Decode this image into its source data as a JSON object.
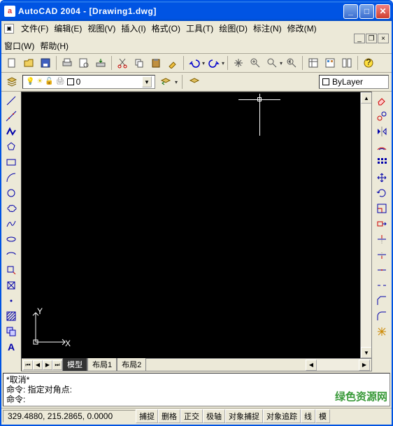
{
  "titlebar": {
    "app_icon_letter": "a",
    "title": "AutoCAD 2004 - [Drawing1.dwg]"
  },
  "menu": {
    "items": [
      {
        "id": "file",
        "label": "文件(F)"
      },
      {
        "id": "edit",
        "label": "编辑(E)"
      },
      {
        "id": "view",
        "label": "视图(V)"
      },
      {
        "id": "insert",
        "label": "插入(I)"
      },
      {
        "id": "format",
        "label": "格式(O)"
      },
      {
        "id": "tools",
        "label": "工具(T)"
      },
      {
        "id": "draw",
        "label": "绘图(D)"
      },
      {
        "id": "dimension",
        "label": "标注(N)"
      },
      {
        "id": "modify",
        "label": "修改(M)"
      },
      {
        "id": "window",
        "label": "窗口(W)"
      },
      {
        "id": "help",
        "label": "帮助(H)"
      }
    ]
  },
  "toolbar_standard": {
    "buttons": [
      {
        "name": "new-icon"
      },
      {
        "name": "open-icon"
      },
      {
        "name": "save-icon"
      },
      {
        "name": "plot-icon"
      },
      {
        "name": "plot-preview-icon"
      },
      {
        "name": "publish-icon"
      },
      {
        "name": "cut-icon"
      },
      {
        "name": "copy-icon"
      },
      {
        "name": "paste-icon"
      },
      {
        "name": "match-prop-icon"
      },
      {
        "name": "undo-icon"
      },
      {
        "name": "redo-icon"
      },
      {
        "name": "pan-icon"
      },
      {
        "name": "zoom-realtime-icon"
      },
      {
        "name": "zoom-window-icon"
      },
      {
        "name": "zoom-previous-icon"
      },
      {
        "name": "properties-icon"
      },
      {
        "name": "design-center-icon"
      },
      {
        "name": "tool-palette-icon"
      },
      {
        "name": "help-icon"
      }
    ]
  },
  "layer": {
    "current": {
      "name": "0"
    },
    "bylayer_label": "ByLayer"
  },
  "draw_toolbar": {
    "buttons": [
      {
        "name": "line-icon"
      },
      {
        "name": "xline-icon"
      },
      {
        "name": "polyline-icon"
      },
      {
        "name": "polygon-icon"
      },
      {
        "name": "rectangle-icon"
      },
      {
        "name": "arc-icon"
      },
      {
        "name": "circle-icon"
      },
      {
        "name": "revcloud-icon"
      },
      {
        "name": "spline-icon"
      },
      {
        "name": "ellipse-icon"
      },
      {
        "name": "ellipse-arc-icon"
      },
      {
        "name": "block-insert-icon"
      },
      {
        "name": "make-block-icon"
      },
      {
        "name": "point-icon"
      },
      {
        "name": "hatch-icon"
      },
      {
        "name": "region-icon"
      },
      {
        "name": "mtext-icon",
        "label": "A"
      }
    ]
  },
  "modify_toolbar": {
    "buttons": [
      {
        "name": "erase-icon"
      },
      {
        "name": "copy-obj-icon"
      },
      {
        "name": "mirror-icon"
      },
      {
        "name": "offset-icon"
      },
      {
        "name": "array-icon"
      },
      {
        "name": "move-icon"
      },
      {
        "name": "rotate-icon"
      },
      {
        "name": "scale-icon"
      },
      {
        "name": "stretch-icon"
      },
      {
        "name": "trim-icon"
      },
      {
        "name": "extend-icon"
      },
      {
        "name": "break-at-point-icon"
      },
      {
        "name": "break-icon"
      },
      {
        "name": "chamfer-icon"
      },
      {
        "name": "fillet-icon"
      },
      {
        "name": "explode-icon"
      }
    ]
  },
  "ucs": {
    "x_label": "X",
    "y_label": "Y"
  },
  "tabs": {
    "items": [
      {
        "label": "模型",
        "active": true
      },
      {
        "label": "布局1",
        "active": false
      },
      {
        "label": "布局2",
        "active": false
      }
    ]
  },
  "command": {
    "line1": "*取消*",
    "line2": "命令: 指定对角点:",
    "line3": "命令:"
  },
  "status": {
    "coords": "329.4880, 215.2865, 0.0000",
    "buttons": [
      {
        "label": "捕捉"
      },
      {
        "label": "删格"
      },
      {
        "label": "正交"
      },
      {
        "label": "极轴"
      },
      {
        "label": "对象捕捉"
      },
      {
        "label": "对象追踪"
      },
      {
        "label": "线"
      },
      {
        "label": "模"
      }
    ]
  },
  "watermark": "绿色资源网"
}
